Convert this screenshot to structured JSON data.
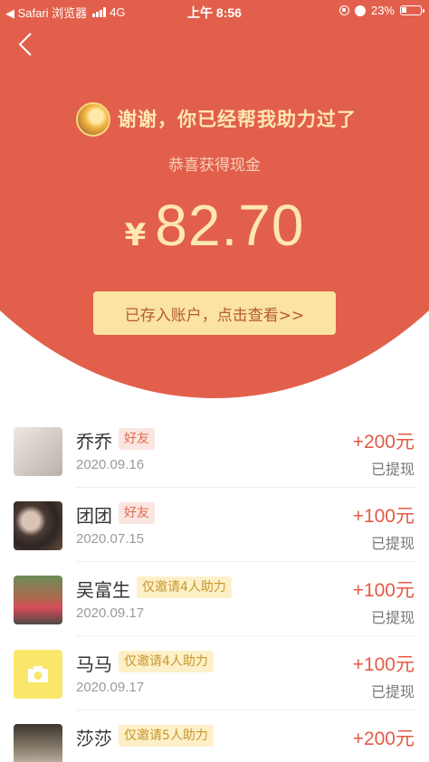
{
  "status_bar": {
    "carrier": "◀ Safari 浏览器",
    "network": "4G",
    "time": "上午 8:56",
    "battery": "23%"
  },
  "hero": {
    "thanks_text": "谢谢，你已经帮我助力过了",
    "congrats_text": "恭喜获得现金",
    "currency": "¥",
    "amount": "82.70",
    "cta_label": "已存入账户，点击查看>>"
  },
  "records": [
    {
      "name": "乔乔",
      "tag": "好友",
      "date": "2020.09.16",
      "amount": "+200元",
      "status": "已提现"
    },
    {
      "name": "团团",
      "tag": "好友",
      "date": "2020.07.15",
      "amount": "+100元",
      "status": "已提现"
    },
    {
      "name": "吴富生",
      "tag": "仅邀请4人助力",
      "date": "2020.09.17",
      "amount": "+100元",
      "status": "已提现"
    },
    {
      "name": "马马",
      "tag": "仅邀请4人助力",
      "date": "2020.09.17",
      "amount": "+100元",
      "status": "已提现"
    },
    {
      "name": "莎莎",
      "tag": "仅邀请5人助力",
      "date": "",
      "amount": "+200元",
      "status": ""
    }
  ],
  "colors": {
    "hero_bg": "#e2604b",
    "gold_text": "#fde7b2",
    "cta_bg": "#fbe3a1",
    "amount_red": "#e25b45"
  },
  "icons": [
    "back-chevron-icon",
    "signal-icon",
    "lock-rotation-icon",
    "alarm-icon",
    "battery-icon",
    "camera-icon"
  ]
}
